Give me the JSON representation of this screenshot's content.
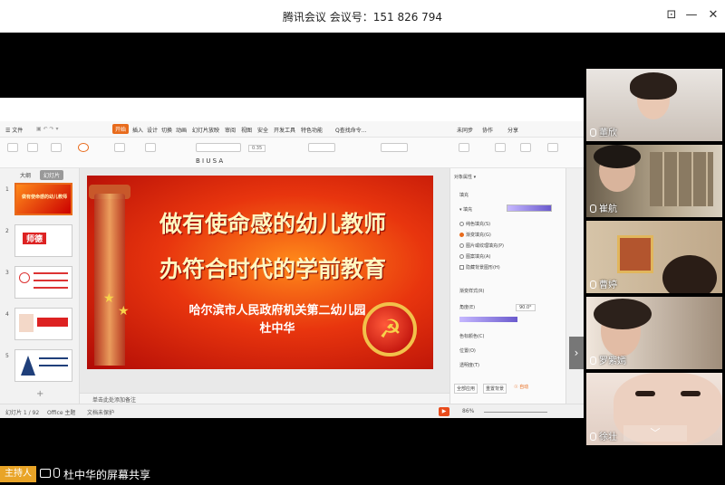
{
  "window": {
    "title": "腾讯会议 会议号：151 826 794",
    "controls": {
      "pin": "⊡",
      "minimize": "—",
      "maximize": "☐",
      "close": "✕"
    }
  },
  "wps": {
    "menu": {
      "file": "☰ 文件",
      "tabs": [
        "开始",
        "插入",
        "设计",
        "切换",
        "动画",
        "幻灯片放映",
        "审阅",
        "视图",
        "安全",
        "开发工具",
        "特色功能"
      ],
      "search": "Q查找命令...",
      "right": [
        "未同步",
        "协作",
        "分享"
      ]
    },
    "toolbar": {
      "font_size": "0.35"
    },
    "thumbnail_tabs": [
      "大纲",
      "幻灯片"
    ],
    "slides": [
      {
        "num": "1",
        "title": "做有使命感的幼儿教师"
      },
      {
        "num": "2",
        "title": "师德"
      },
      {
        "num": "3",
        "title": ""
      },
      {
        "num": "4",
        "title": ""
      },
      {
        "num": "5",
        "title": ""
      }
    ],
    "slide": {
      "line1": "做有使命感的幼儿教师",
      "line2": "办符合时代的学前教育",
      "line3": "哈尔滨市人民政府机关第二幼儿园",
      "line4": "杜中华"
    },
    "notes_placeholder": "单击此处添加备注",
    "props": {
      "header": "对象属性 ▾",
      "tab": "填充",
      "section": "▾ 填充",
      "options": [
        "纯色填充(S)",
        "渐变填充(G)",
        "图片或纹理填充(P)",
        "图案填充(A)",
        "隐藏背景图形(H)"
      ],
      "selected": 1,
      "labels": [
        "渐变样式(R)",
        "角度(E)",
        "色标颜色(C)",
        "位置(O)",
        "透明度(T)"
      ],
      "angle": "90.0°",
      "bottom_buttons": [
        "全部应用",
        "重置背景",
        "☉ 自动"
      ]
    },
    "status": {
      "slide_index": "幻灯片 1 / 92",
      "theme": "Office 主题",
      "protect": "文档未保护",
      "zoom": "86%"
    }
  },
  "participants": [
    {
      "name": "董欣",
      "bg": "#d8cfc6"
    },
    {
      "name": "崔航",
      "bg": "#9a8e7a"
    },
    {
      "name": "曹婷",
      "bg": "#c8b59a"
    },
    {
      "name": "罗紫嫣",
      "bg": "#b7a89a"
    },
    {
      "name": "徐壮",
      "bg": "#e1d4cc"
    }
  ],
  "bottom": {
    "host_label": "主持人",
    "share_text": "杜中华的屏幕共享"
  },
  "colors": {
    "accent": "#e86b1c",
    "host": "#e9a427"
  }
}
